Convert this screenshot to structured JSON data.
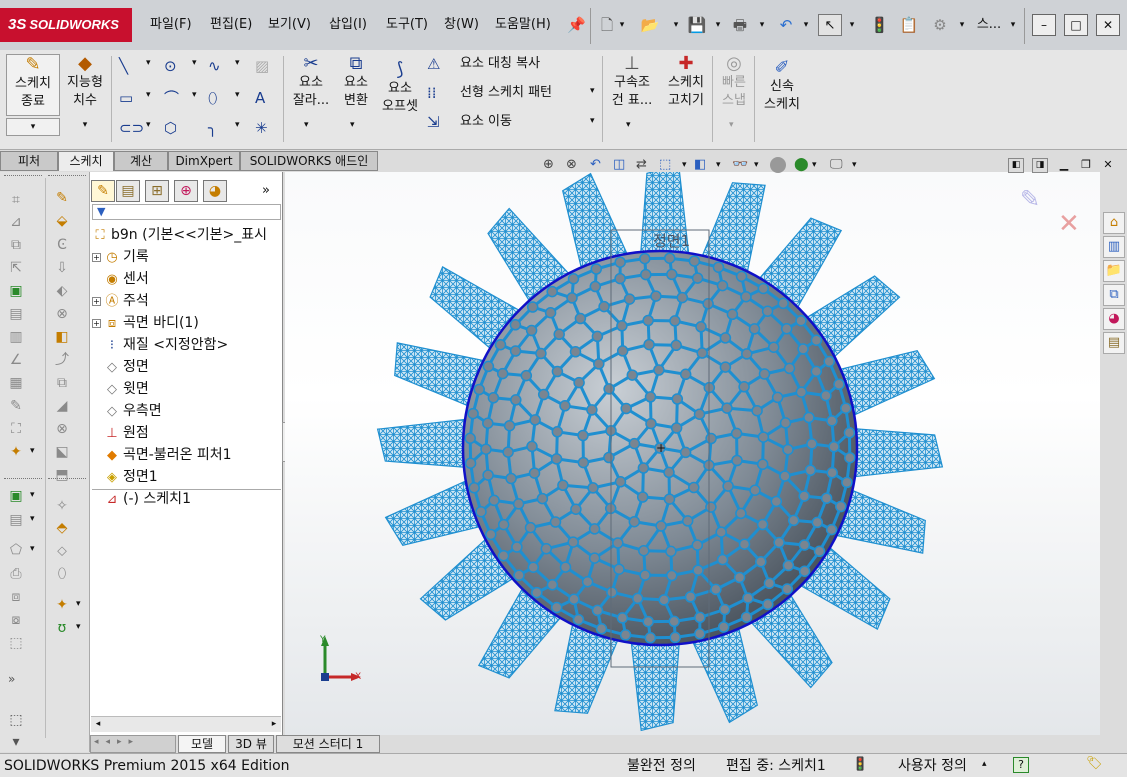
{
  "app": {
    "logo_text": "SOLIDWORKS",
    "logo_mark": "3S"
  },
  "menu": [
    "파일(F)",
    "편집(E)",
    "보기(V)",
    "삽입(I)",
    "도구(T)",
    "창(W)",
    "도움말(H)"
  ],
  "window_buttons": {
    "minimize": "–",
    "restore": "□",
    "close": "✕"
  },
  "quick_access": {
    "search_label": "스..."
  },
  "ribbon": {
    "sketch_exit": [
      "스케치",
      "종료"
    ],
    "smart_dim": [
      "지능형",
      "치수"
    ],
    "trim": [
      "요소",
      "잘라..."
    ],
    "convert": [
      "요소",
      "변환"
    ],
    "offset": [
      "요소",
      "오프셋"
    ],
    "mirror": "요소 대칭 복사",
    "linear_pattern": "선형 스케치 패턴",
    "move": "요소 이동",
    "relations": [
      "구속조",
      "건 표..."
    ],
    "repair": [
      "스케치",
      "고치기"
    ],
    "quick_snap": [
      "빠른",
      "스냅"
    ],
    "rapid_sketch": [
      "신속",
      "스케치"
    ]
  },
  "command_tabs": [
    "피처",
    "스케치",
    "계산",
    "DimXpert",
    "SOLIDWORKS 애드인"
  ],
  "feature_tree": {
    "root": "b9n  (기본<<기본>_표시",
    "items": [
      {
        "label": "기록",
        "expand": true
      },
      {
        "label": "센서",
        "expand": false
      },
      {
        "label": "주석",
        "expand": true
      },
      {
        "label": "곡면 바디(1)",
        "expand": true
      },
      {
        "label": "재질 <지정안함>",
        "expand": false
      },
      {
        "label": "정면",
        "expand": false
      },
      {
        "label": "윗면",
        "expand": false
      },
      {
        "label": "우측면",
        "expand": false
      },
      {
        "label": "원점",
        "expand": false
      },
      {
        "label": "곡면-불러온 피처1",
        "expand": false
      },
      {
        "label": "정면1",
        "expand": false
      },
      {
        "label": "(-) 스케치1",
        "expand": false
      }
    ]
  },
  "viewport": {
    "plane_label": "정면1",
    "axis_x": "X",
    "axis_y": "Y"
  },
  "bottom_tabs": [
    "모델",
    "3D 뷰",
    "모션 스터디 1"
  ],
  "status": {
    "product": "SOLIDWORKS Premium 2015 x64 Edition",
    "definition": "불완전 정의",
    "editing": "편집 중: 스케치1",
    "units": "사용자 정의",
    "help": "?"
  },
  "colors": {
    "mesh": "#1f8fd0",
    "circle": "#1010c8",
    "logo_bg": "#c8102e",
    "sphere": "#7a8590"
  }
}
